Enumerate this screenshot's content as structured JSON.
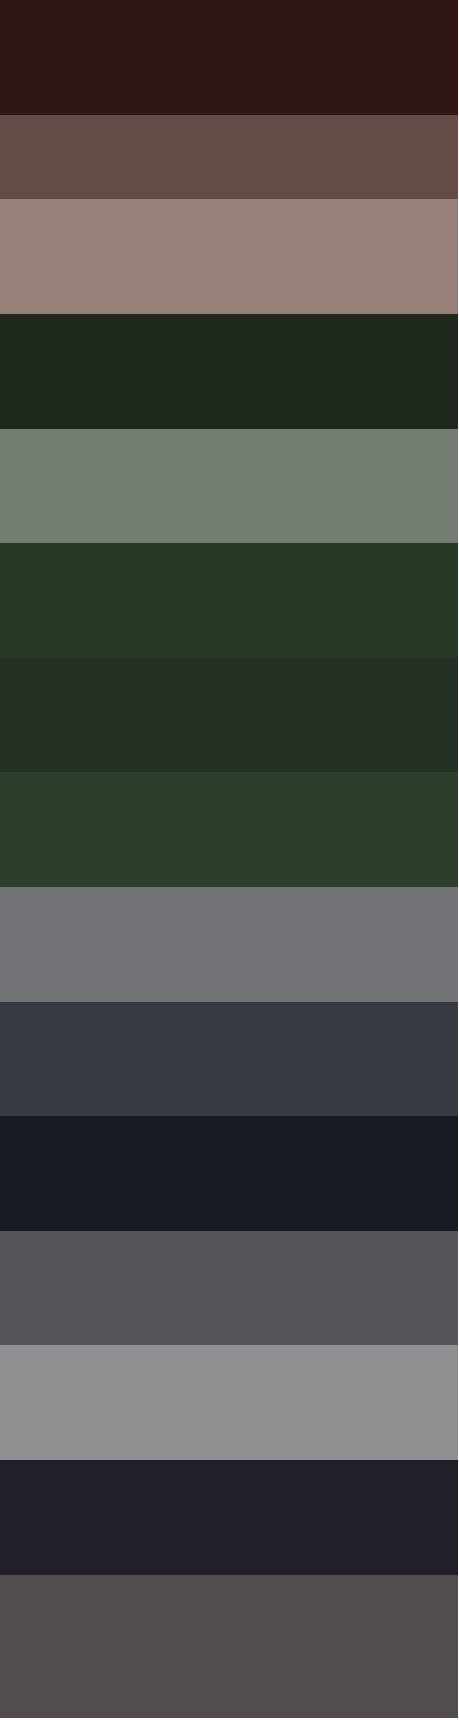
{
  "swatches": [
    {
      "color": "#301515"
    },
    {
      "color": "#654b47"
    },
    {
      "color": "#978077"
    },
    {
      "color": "#1e281d"
    },
    {
      "color": "#737d72"
    },
    {
      "color": "#283826"
    },
    {
      "color": "#233023"
    },
    {
      "color": "#2e3e2c"
    },
    {
      "color": "#727377"
    },
    {
      "color": "#383a43"
    },
    {
      "color": "#171923"
    },
    {
      "color": "#54555a"
    },
    {
      "color": "#8f8f91"
    },
    {
      "color": "#211f29"
    },
    {
      "color": "#524c50"
    }
  ]
}
